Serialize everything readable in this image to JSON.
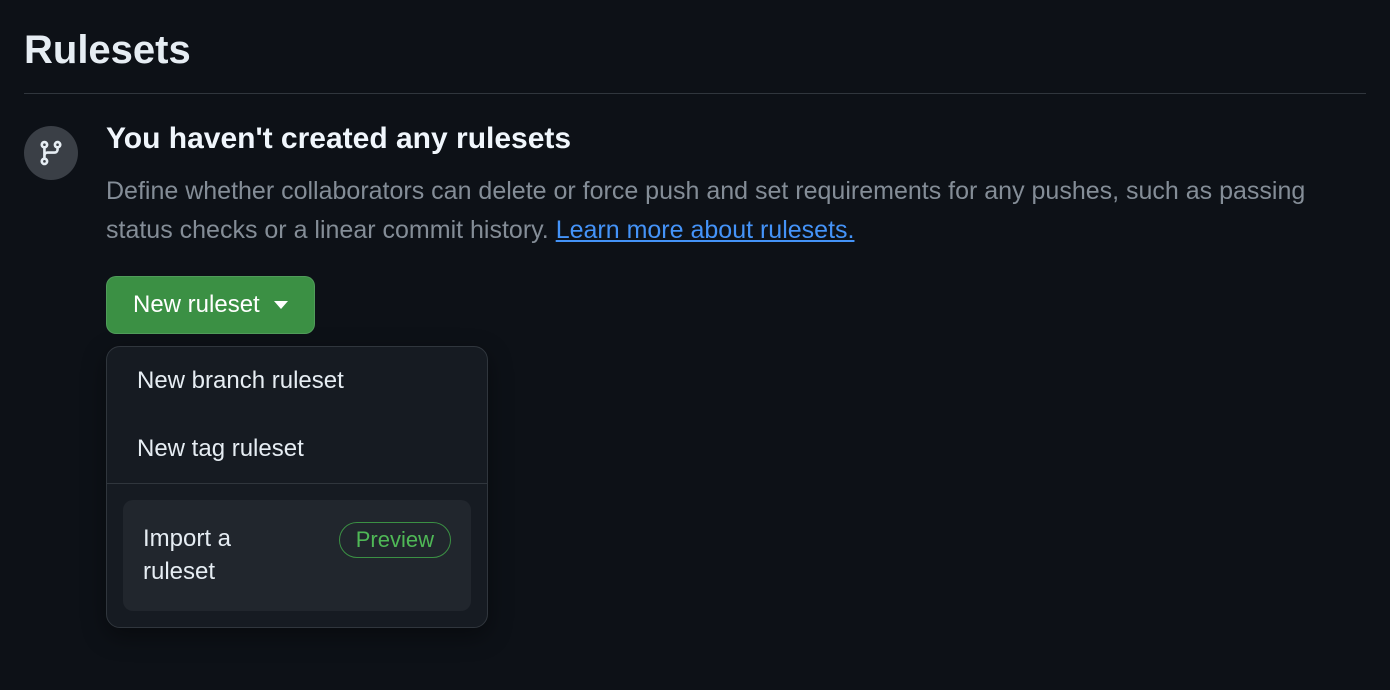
{
  "page": {
    "title": "Rulesets"
  },
  "empty": {
    "heading": "You haven't created any rulesets",
    "description": "Define whether collaborators can delete or force push and set requirements for any pushes, such as passing status checks or a linear commit history. ",
    "learn_more": "Learn more about rulesets."
  },
  "button": {
    "new_ruleset": "New ruleset"
  },
  "menu": {
    "branch": "New branch ruleset",
    "tag": "New tag ruleset",
    "import": "Import a ruleset",
    "preview_badge": "Preview"
  }
}
